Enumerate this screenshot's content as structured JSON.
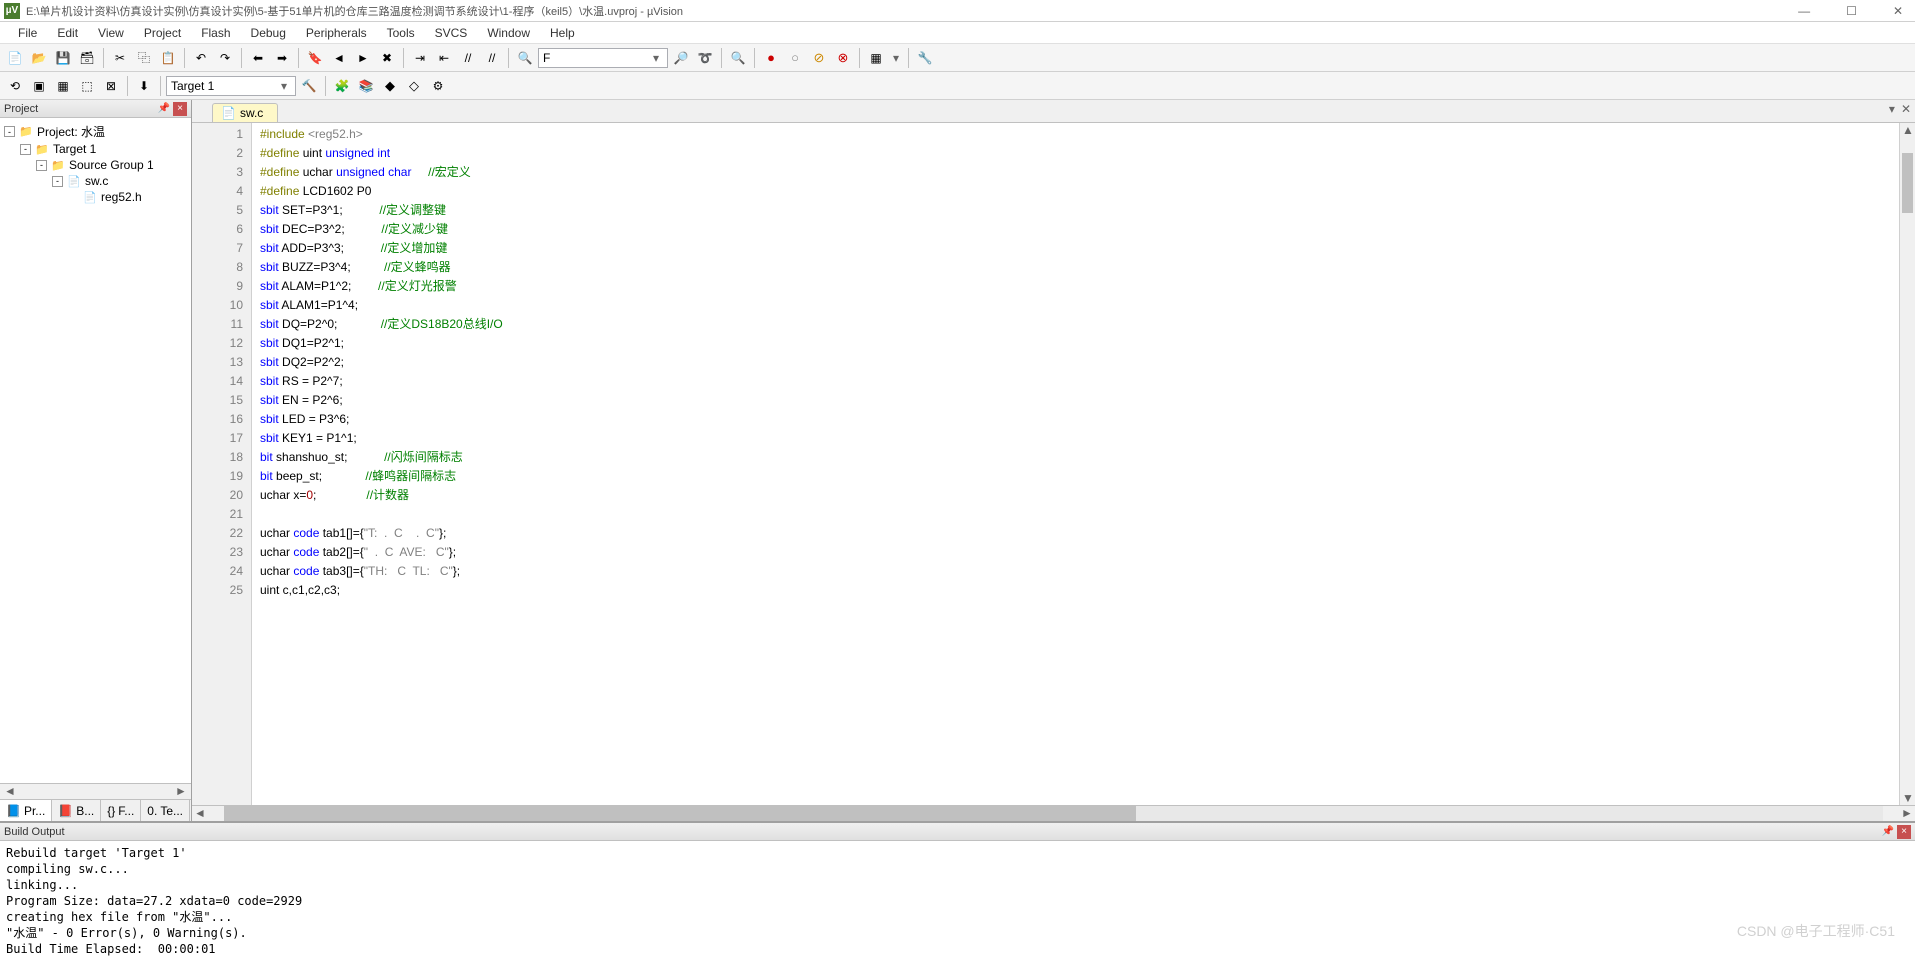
{
  "title": "E:\\单片机设计资料\\仿真设计实例\\仿真设计实例\\5-基于51单片机的仓库三路温度检测调节系统设计\\1-程序（keil5）\\水温.uvproj - µVision",
  "menu": [
    "File",
    "Edit",
    "View",
    "Project",
    "Flash",
    "Debug",
    "Peripherals",
    "Tools",
    "SVCS",
    "Window",
    "Help"
  ],
  "target_combo": "Target 1",
  "toolbar_text": "F",
  "project_panel": {
    "title": "Project",
    "tree": [
      {
        "indent": 0,
        "toggle": "-",
        "icon": "📁",
        "label": "Project: 水温",
        "iconcolor": "#6aa0d8"
      },
      {
        "indent": 1,
        "toggle": "-",
        "icon": "📁",
        "label": "Target 1",
        "iconcolor": "#e8b040"
      },
      {
        "indent": 2,
        "toggle": "-",
        "icon": "📁",
        "label": "Source Group 1",
        "iconcolor": "#e8b040"
      },
      {
        "indent": 3,
        "toggle": "-",
        "icon": "📄",
        "label": "sw.c",
        "iconcolor": "#888"
      },
      {
        "indent": 4,
        "toggle": "",
        "icon": "📄",
        "label": "reg52.h",
        "iconcolor": "#888"
      }
    ],
    "tabs": [
      {
        "icon": "📘",
        "label": "Pr...",
        "active": true
      },
      {
        "icon": "📕",
        "label": "B..."
      },
      {
        "icon": "{}",
        "label": "F..."
      },
      {
        "icon": "0.",
        "label": "Te..."
      }
    ]
  },
  "editor": {
    "tab": "sw.c",
    "lines": [
      {
        "n": 1,
        "seg": [
          {
            "c": "kw-pp",
            "t": "#include "
          },
          {
            "c": "kw-str",
            "t": "<reg52.h>"
          }
        ]
      },
      {
        "n": 2,
        "seg": [
          {
            "c": "kw-pp",
            "t": "#define "
          },
          {
            "c": "",
            "t": "uint "
          },
          {
            "c": "kw-type",
            "t": "unsigned int"
          }
        ]
      },
      {
        "n": 3,
        "seg": [
          {
            "c": "kw-pp",
            "t": "#define "
          },
          {
            "c": "",
            "t": "uchar "
          },
          {
            "c": "kw-type",
            "t": "unsigned char"
          },
          {
            "c": "",
            "t": "     "
          },
          {
            "c": "kw-cmt",
            "t": "//宏定义"
          }
        ]
      },
      {
        "n": 4,
        "seg": [
          {
            "c": "kw-pp",
            "t": "#define "
          },
          {
            "c": "",
            "t": "LCD1602 P0"
          }
        ]
      },
      {
        "n": 5,
        "seg": [
          {
            "c": "kw-type",
            "t": "sbit"
          },
          {
            "c": "",
            "t": " SET=P3^1;           "
          },
          {
            "c": "kw-cmt",
            "t": "//定义调整键"
          }
        ]
      },
      {
        "n": 6,
        "seg": [
          {
            "c": "kw-type",
            "t": "sbit"
          },
          {
            "c": "",
            "t": " DEC=P3^2;           "
          },
          {
            "c": "kw-cmt",
            "t": "//定义减少键"
          }
        ]
      },
      {
        "n": 7,
        "seg": [
          {
            "c": "kw-type",
            "t": "sbit"
          },
          {
            "c": "",
            "t": " ADD=P3^3;           "
          },
          {
            "c": "kw-cmt",
            "t": "//定义增加键"
          }
        ]
      },
      {
        "n": 8,
        "seg": [
          {
            "c": "kw-type",
            "t": "sbit"
          },
          {
            "c": "",
            "t": " BUZZ=P3^4;          "
          },
          {
            "c": "kw-cmt",
            "t": "//定义蜂鸣器"
          }
        ]
      },
      {
        "n": 9,
        "seg": [
          {
            "c": "kw-type",
            "t": "sbit"
          },
          {
            "c": "",
            "t": " ALAM=P1^2;        "
          },
          {
            "c": "kw-cmt",
            "t": "//定义灯光报警"
          }
        ]
      },
      {
        "n": 10,
        "seg": [
          {
            "c": "kw-type",
            "t": "sbit"
          },
          {
            "c": "",
            "t": " ALAM1=P1^4;"
          }
        ]
      },
      {
        "n": 11,
        "seg": [
          {
            "c": "kw-type",
            "t": "sbit"
          },
          {
            "c": "",
            "t": " DQ=P2^0;             "
          },
          {
            "c": "kw-cmt",
            "t": "//定义DS18B20总线I/O"
          }
        ]
      },
      {
        "n": 12,
        "seg": [
          {
            "c": "kw-type",
            "t": "sbit"
          },
          {
            "c": "",
            "t": " DQ1=P2^1;"
          }
        ]
      },
      {
        "n": 13,
        "seg": [
          {
            "c": "kw-type",
            "t": "sbit"
          },
          {
            "c": "",
            "t": " DQ2=P2^2;"
          }
        ]
      },
      {
        "n": 14,
        "seg": [
          {
            "c": "kw-type",
            "t": "sbit"
          },
          {
            "c": "",
            "t": " RS = P2^7;"
          }
        ]
      },
      {
        "n": 15,
        "seg": [
          {
            "c": "kw-type",
            "t": "sbit"
          },
          {
            "c": "",
            "t": " EN = P2^6;"
          }
        ]
      },
      {
        "n": 16,
        "seg": [
          {
            "c": "kw-type",
            "t": "sbit"
          },
          {
            "c": "",
            "t": " LED = P3^6;"
          }
        ]
      },
      {
        "n": 17,
        "seg": [
          {
            "c": "kw-type",
            "t": "sbit"
          },
          {
            "c": "",
            "t": " KEY1 = P1^1;"
          }
        ]
      },
      {
        "n": 18,
        "seg": [
          {
            "c": "kw-type",
            "t": "bit"
          },
          {
            "c": "",
            "t": " shanshuo_st;           "
          },
          {
            "c": "kw-cmt",
            "t": "//闪烁间隔标志"
          }
        ]
      },
      {
        "n": 19,
        "seg": [
          {
            "c": "kw-type",
            "t": "bit"
          },
          {
            "c": "",
            "t": " beep_st;             "
          },
          {
            "c": "kw-cmt",
            "t": "//蜂鸣器间隔标志"
          }
        ]
      },
      {
        "n": 20,
        "seg": [
          {
            "c": "",
            "t": "uchar x="
          },
          {
            "c": "kw-red",
            "t": "0"
          },
          {
            "c": "",
            "t": ";               "
          },
          {
            "c": "kw-cmt",
            "t": "//计数器"
          }
        ]
      },
      {
        "n": 21,
        "seg": [
          {
            "c": "",
            "t": ""
          }
        ]
      },
      {
        "n": 22,
        "seg": [
          {
            "c": "",
            "t": "uchar "
          },
          {
            "c": "kw-type",
            "t": "code"
          },
          {
            "c": "",
            "t": " tab1[]={"
          },
          {
            "c": "kw-str",
            "t": "\"T:  .  C    .  C\""
          },
          {
            "c": "",
            "t": "};"
          }
        ]
      },
      {
        "n": 23,
        "seg": [
          {
            "c": "",
            "t": "uchar "
          },
          {
            "c": "kw-type",
            "t": "code"
          },
          {
            "c": "",
            "t": " tab2[]={"
          },
          {
            "c": "kw-str",
            "t": "\"  .  C  AVE:   C\""
          },
          {
            "c": "",
            "t": "};"
          }
        ]
      },
      {
        "n": 24,
        "seg": [
          {
            "c": "",
            "t": "uchar "
          },
          {
            "c": "kw-type",
            "t": "code"
          },
          {
            "c": "",
            "t": " tab3[]={"
          },
          {
            "c": "kw-str",
            "t": "\"TH:   C  TL:   C\""
          },
          {
            "c": "",
            "t": "};"
          }
        ]
      },
      {
        "n": 25,
        "seg": [
          {
            "c": "",
            "t": "uint c,c1,c2,c3;"
          }
        ]
      }
    ]
  },
  "build": {
    "title": "Build Output",
    "text": "Rebuild target 'Target 1'\ncompiling sw.c...\nlinking...\nProgram Size: data=27.2 xdata=0 code=2929\ncreating hex file from \"水温\"...\n\"水温\" - 0 Error(s), 0 Warning(s).\nBuild Time Elapsed:  00:00:01"
  },
  "watermark": "CSDN @电子工程师·C51"
}
